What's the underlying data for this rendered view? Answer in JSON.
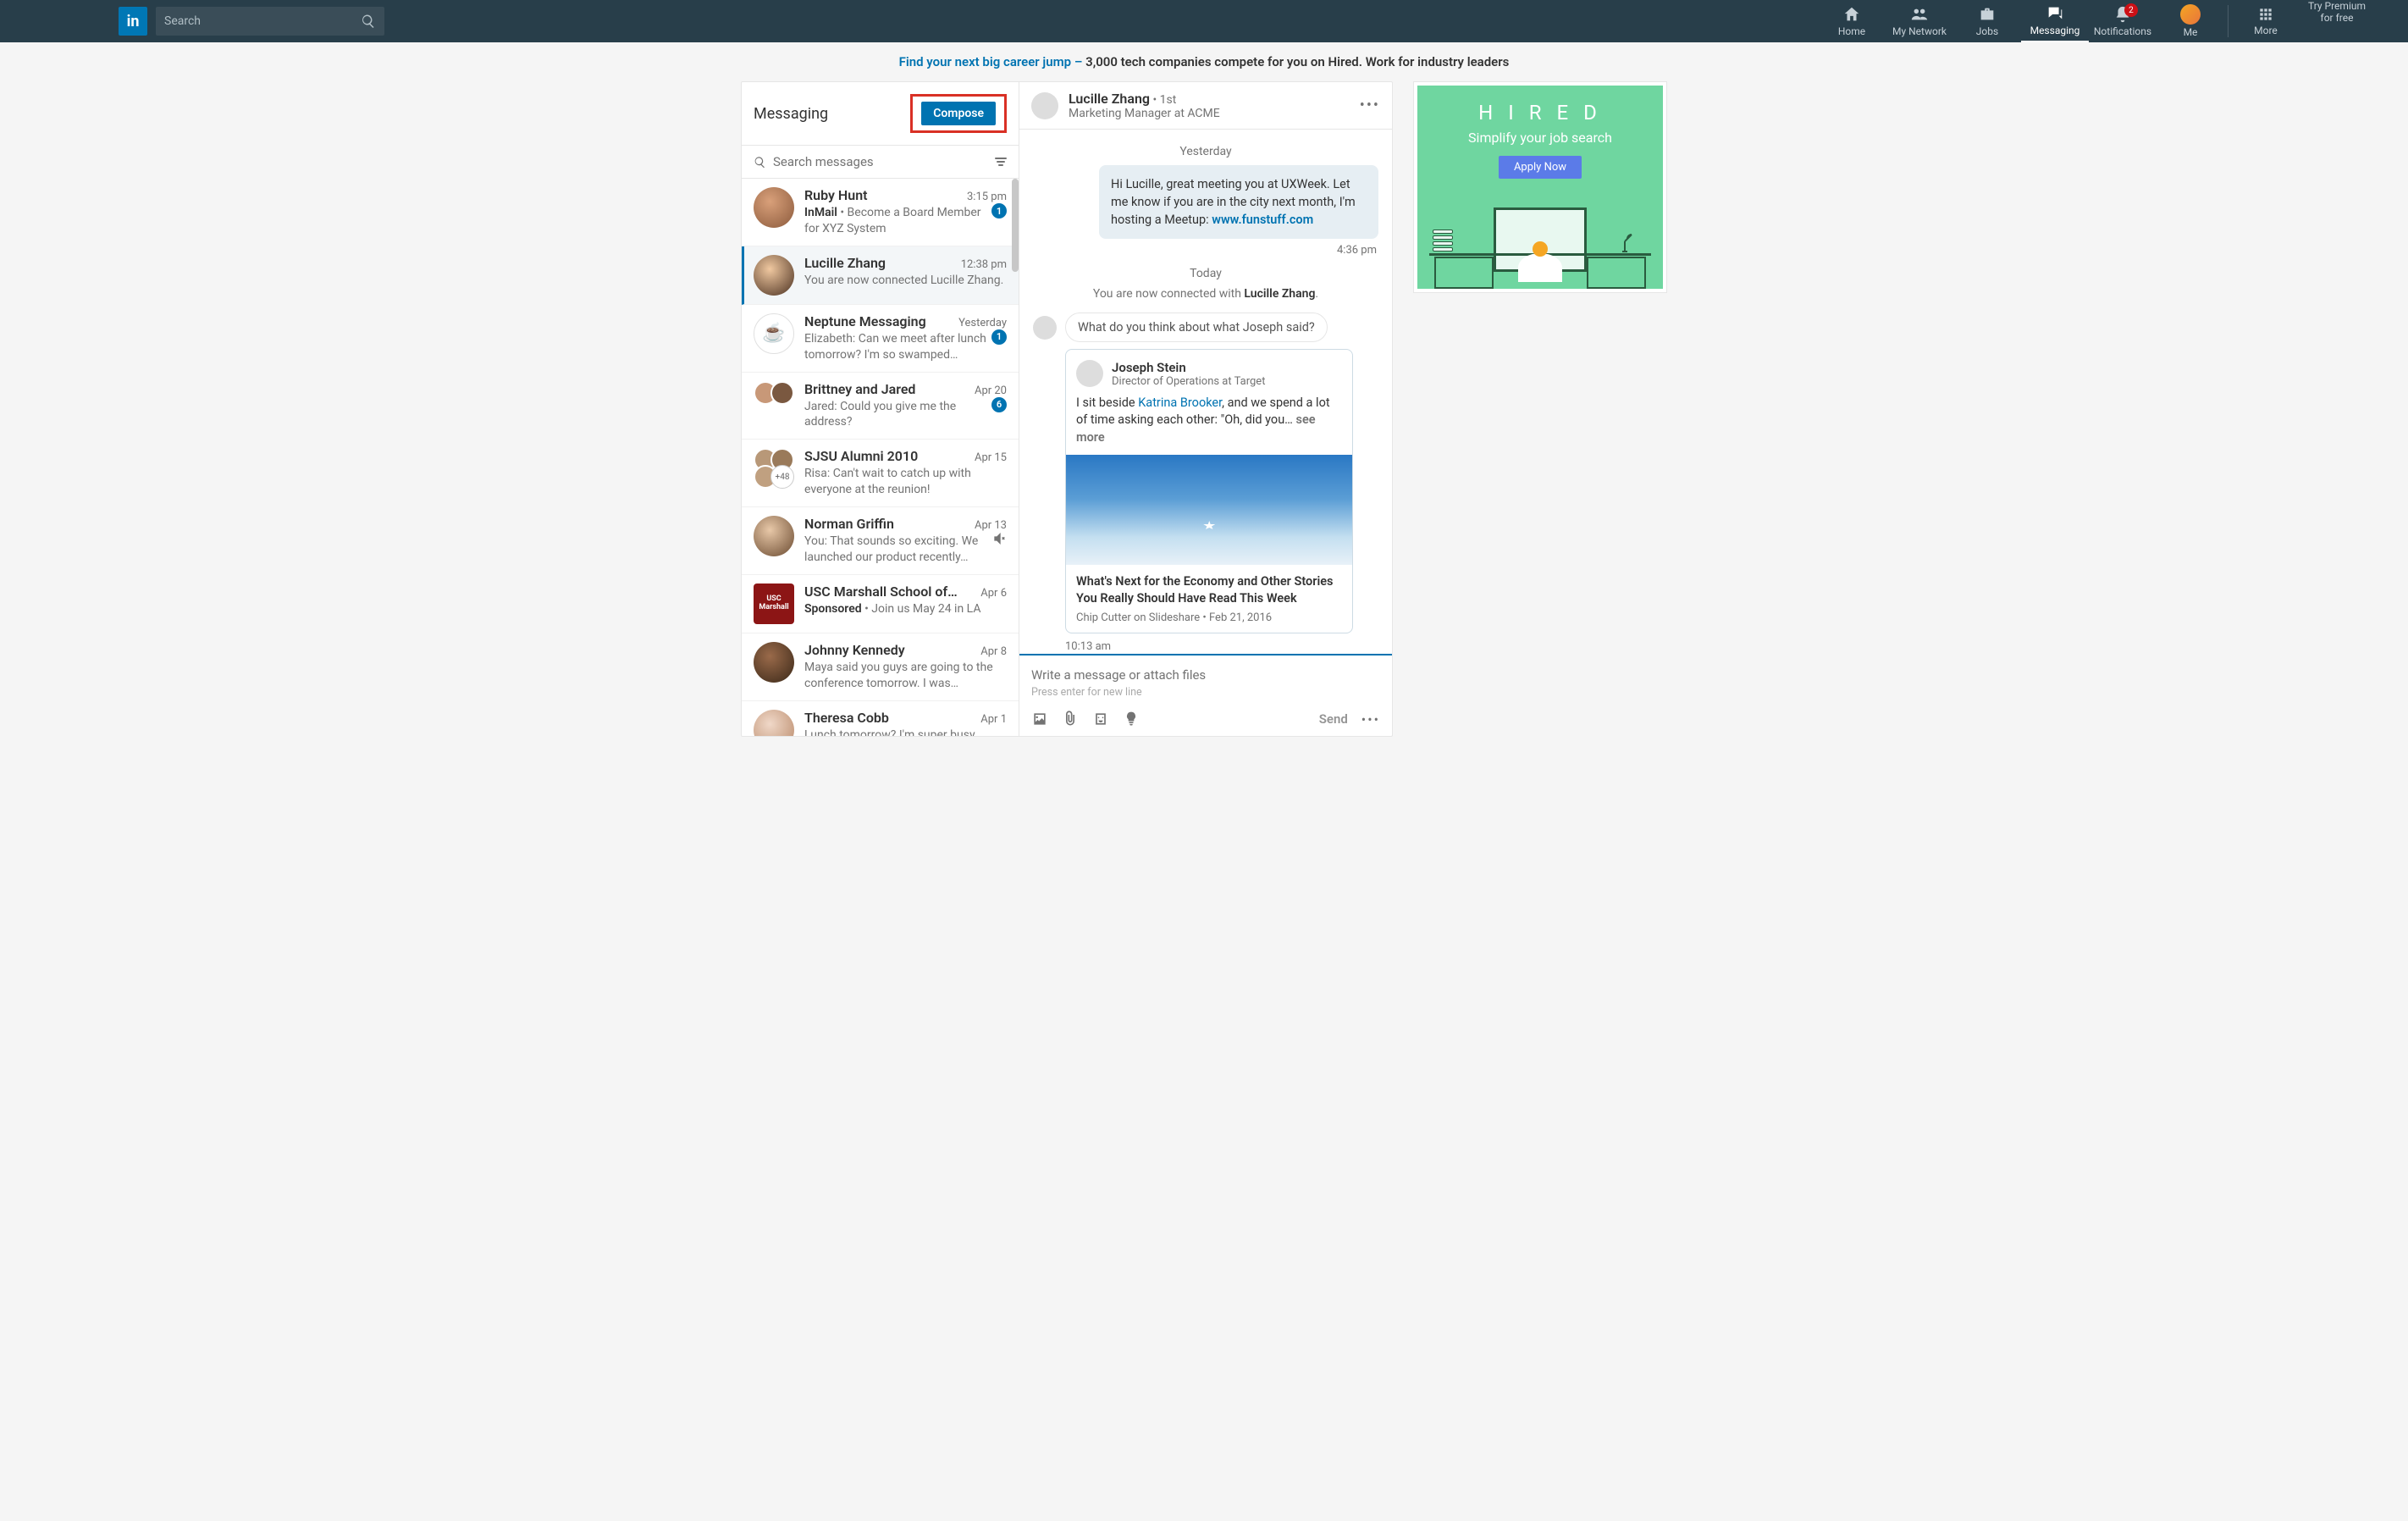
{
  "header": {
    "search_placeholder": "Search",
    "nav": {
      "home": "Home",
      "network": "My Network",
      "jobs": "Jobs",
      "messaging": "Messaging",
      "notifications": "Notifications",
      "notif_badge": "2",
      "me": "Me",
      "more": "More"
    },
    "premium_l1": "Try Premium",
    "premium_l2": "for free"
  },
  "promo": {
    "link": "Find your next big career jump –",
    "text": " 3,000 tech companies compete for you on Hired. Work for industry leaders"
  },
  "left": {
    "title": "Messaging",
    "compose": "Compose",
    "search_placeholder": "Search messages",
    "convos": [
      {
        "name": "Ruby Hunt",
        "time": "3:15 pm",
        "preview_bold": "InMail",
        "preview": " • Become a Board Member for XYZ System",
        "badge": "1"
      },
      {
        "name": "Lucille Zhang",
        "time": "12:38 pm",
        "preview": "You are now connected Lucille Zhang."
      },
      {
        "name": "Neptune Messaging",
        "time": "Yesterday",
        "preview": "Elizabeth: Can we meet after lunch tomorrow? I'm so swamped…",
        "badge": "1"
      },
      {
        "name": "Brittney and Jared",
        "time": "Apr 20",
        "preview": "Jared: Could you give me the address?",
        "badge": "6"
      },
      {
        "name": "SJSU Alumni 2010",
        "time": "Apr 15",
        "preview": "Risa: Can't wait to catch up with everyone at the reunion!",
        "more": "+48"
      },
      {
        "name": "Norman Griffin",
        "time": "Apr 13",
        "preview": "You: That sounds so exciting. We launched our product recently…",
        "muted": true
      },
      {
        "name": "USC Marshall School of…",
        "time": "Apr 6",
        "preview_bold": "Sponsored",
        "preview": " • Join us May 24 in LA"
      },
      {
        "name": "Johnny Kennedy",
        "time": "Apr 8",
        "preview": "Maya said you guys are going to the conference tomorrow. I was…"
      },
      {
        "name": "Theresa Cobb",
        "time": "Apr 1",
        "preview": "Lunch tomorrow? I'm super busy"
      }
    ]
  },
  "thread": {
    "name": "Lucille Zhang",
    "degree": " • 1st",
    "subtitle": "Marketing Manager at ACME",
    "day1": "Yesterday",
    "out_msg_a": "Hi Lucille, great meeting you at UXWeek. Let me know if you are in the city next month, I'm hosting a Meetup:  ",
    "out_msg_link": "www.funstuff.com",
    "out_time": "4:36 pm",
    "day2": "Today",
    "system_a": "You are now connected with ",
    "system_b": "Lucille Zhang",
    "system_c": ".",
    "in_msg": "What do you think about what Joseph said?",
    "card": {
      "name": "Joseph Stein",
      "title": "Director of Operations at Target",
      "text_a": "I sit beside ",
      "text_link": "Katrina Brooker",
      "text_b": ", and we spend  a lot of time asking each other: \"Oh, did you…  ",
      "more": "see more",
      "cap_title": "What's Next for the Economy and Other Stories You Really Should Have Read This Week",
      "cap_meta": "Chip Cutter on Slideshare  •  Feb 21, 2016"
    },
    "in_time": "10:13 am",
    "compose_ph": "Write a message or attach files",
    "compose_hint": "Press enter for new line",
    "send": "Send"
  },
  "ad": {
    "title": "H I R E D",
    "sub": "Simplify your job search",
    "btn": "Apply Now"
  }
}
